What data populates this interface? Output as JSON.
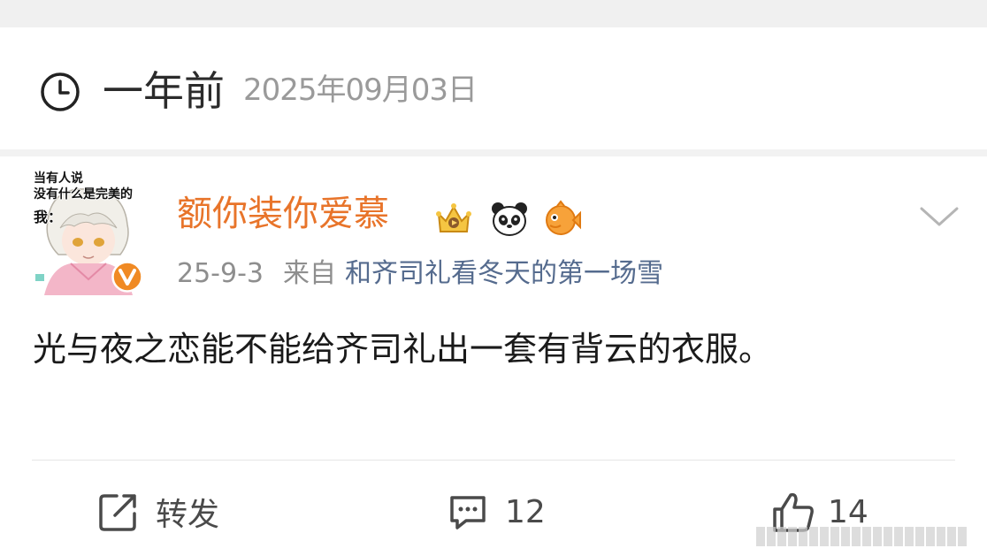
{
  "header": {
    "relative_time": "一年前",
    "absolute_date": "2025年09月03日",
    "icon": "clock-icon"
  },
  "post": {
    "avatar": {
      "caption_lines": [
        "当有人说",
        "没有什么是完美的",
        "我："
      ],
      "verified_icon": "verified-v-icon",
      "verified_color": "#f08a24"
    },
    "username": "额你装你爱慕",
    "username_color": "#e8742a",
    "badges": [
      "crown-badge-icon",
      "panda-badge-icon",
      "fish-badge-icon"
    ],
    "date": "25-9-3",
    "from_label": "来自",
    "source": "和齐司礼看冬天的第一场雪",
    "source_color": "#556b8e",
    "text": "光与夜之恋能不能给齐司礼出一套有背云的衣服。"
  },
  "actions": {
    "repost": {
      "icon": "repost-icon",
      "label": "转发"
    },
    "comment": {
      "icon": "comment-icon",
      "count": "12"
    },
    "like": {
      "icon": "like-icon",
      "count": "14"
    }
  }
}
